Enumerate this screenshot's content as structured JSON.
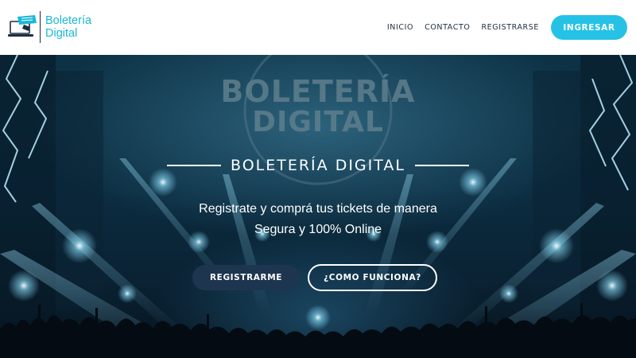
{
  "header": {
    "logo_line1": "Boletería",
    "logo_line2": "Digital",
    "nav": [
      "INICIO",
      "CONTACTO",
      "REGISTRARSE"
    ],
    "login_label": "INGRESAR"
  },
  "hero": {
    "bg_title_line1": "BOLETERÍA",
    "bg_title_line2": "DIGITAL",
    "title": "BOLETERÍA DIGITAL",
    "subtitle_line1": "Registrate y comprá tus tickets de manera",
    "subtitle_line2": "Segura y 100% Online",
    "register_label": "REGISTRARME",
    "how_label": "¿COMO FUNCIONA?"
  },
  "colors": {
    "brand": "#1ab8d6",
    "login_button": "#25c2e6",
    "register_button": "#1e3550"
  },
  "icons": [
    "ticket-laptop-logo-icon"
  ]
}
